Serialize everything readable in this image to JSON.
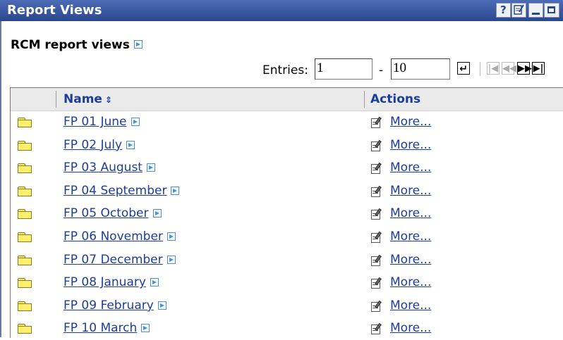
{
  "window": {
    "title": "Report Views",
    "buttons": {
      "help": "?"
    }
  },
  "heading": "RCM report views",
  "pagination": {
    "entries_label": "Entries:",
    "from": "1",
    "to": "10",
    "dash": "-",
    "go_glyph": "↵",
    "first_glyph": "|◀",
    "prev_glyph": "◀◀",
    "next_glyph": "▶▶",
    "last_glyph": "▶|"
  },
  "table": {
    "columns": {
      "name": "Name",
      "sort_icon": "⇕",
      "actions": "Actions"
    },
    "rows": [
      {
        "name": "FP 01 June",
        "action": "More..."
      },
      {
        "name": "FP 02 July",
        "action": "More..."
      },
      {
        "name": "FP 03 August",
        "action": "More..."
      },
      {
        "name": "FP 04 September",
        "action": "More..."
      },
      {
        "name": "FP 05 October",
        "action": "More..."
      },
      {
        "name": "FP 06 November",
        "action": "More..."
      },
      {
        "name": "FP 07 December",
        "action": "More..."
      },
      {
        "name": "FP 08 January",
        "action": "More..."
      },
      {
        "name": "FP 09 February",
        "action": "More..."
      },
      {
        "name": "FP 10 March",
        "action": "More..."
      }
    ]
  },
  "colors": {
    "titlebar": "#2a468f",
    "link": "#1c3d9e",
    "folder": "#ffef6e"
  }
}
